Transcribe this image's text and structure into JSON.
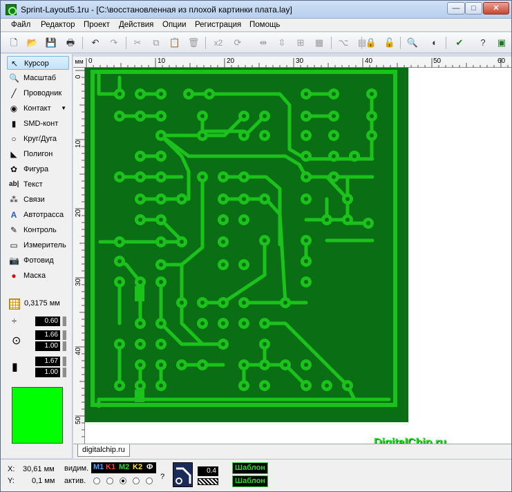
{
  "window": {
    "title": "Sprint-Layout5.1ru - [C:\\восстановленная из плохой картинки плата.lay]",
    "minimize": "—",
    "maximize": "□",
    "close": "✕"
  },
  "menu": [
    "Файл",
    "Редактор",
    "Проект",
    "Действия",
    "Опции",
    "Регистрация",
    "Помощь"
  ],
  "toolbar": {
    "zoom_x2": "x2"
  },
  "tools": [
    {
      "name": "cursor",
      "label": "Курсор",
      "icon": "cursor-icon",
      "glyph": "↖"
    },
    {
      "name": "zoom",
      "label": "Масштаб",
      "icon": "magnifier-icon",
      "glyph": "🔍"
    },
    {
      "name": "track",
      "label": "Проводник",
      "icon": "track-icon",
      "glyph": "╱"
    },
    {
      "name": "pad",
      "label": "Контакт",
      "icon": "pad-icon",
      "glyph": "◉"
    },
    {
      "name": "smd",
      "label": "SMD-конт",
      "icon": "smd-icon",
      "glyph": "▮"
    },
    {
      "name": "circle",
      "label": "Круг/Дуга",
      "icon": "circle-icon",
      "glyph": "○"
    },
    {
      "name": "polygon",
      "label": "Полигон",
      "icon": "polygon-icon",
      "glyph": "◣"
    },
    {
      "name": "shape",
      "label": "Фигура",
      "icon": "shape-icon",
      "glyph": "✿"
    },
    {
      "name": "text",
      "label": "Текст",
      "icon": "text-icon",
      "glyph": "ab|"
    },
    {
      "name": "links",
      "label": "Связи",
      "icon": "links-icon",
      "glyph": "⁂"
    },
    {
      "name": "autoroute",
      "label": "Автотрасса",
      "icon": "autoroute-icon",
      "glyph": "A"
    },
    {
      "name": "control",
      "label": "Контроль",
      "icon": "control-icon",
      "glyph": "✎"
    },
    {
      "name": "measure",
      "label": "Измеритель",
      "icon": "ruler-icon",
      "glyph": "▭"
    },
    {
      "name": "photoview",
      "label": "Фотовид",
      "icon": "camera-icon",
      "glyph": "📷"
    },
    {
      "name": "mask",
      "label": "Маска",
      "icon": "mask-icon",
      "glyph": "●"
    }
  ],
  "grid": {
    "value": "0,3175 мм"
  },
  "params": {
    "track_width": "0.60",
    "pad_outer": "1.66",
    "pad_inner": "1.00",
    "smd_width": "1.67",
    "smd_height": "1.00"
  },
  "colors": {
    "board": "#0a6e14",
    "copper": "#1cc21c",
    "accent": "#00ff00",
    "layer_m1": "#4da3ff",
    "layer_k1": "#ff3b3b",
    "layer_m2": "#2bd92b",
    "layer_k2": "#ffe14d",
    "layer_f": "#ffffff"
  },
  "ruler": {
    "unit": "мм",
    "top_labels": [
      "0",
      "10",
      "20",
      "30",
      "40",
      "50",
      "60"
    ],
    "left_labels": [
      "0",
      "10",
      "20",
      "30",
      "40",
      "50"
    ]
  },
  "tab": {
    "label": "digitalchip.ru"
  },
  "watermark": "DigitalChip.ru",
  "status": {
    "x_label": "X:",
    "x_value": "30,61 мм",
    "y_label": "Y:",
    "y_value": "0,1 мм",
    "visible_label": "видим.",
    "active_label": "актив.",
    "layers": [
      "M1",
      "K1",
      "M2",
      "K2",
      "Ф"
    ],
    "help": "?",
    "track_width": "0.4",
    "template1": "Шаблон",
    "template2": "Шаблон"
  }
}
